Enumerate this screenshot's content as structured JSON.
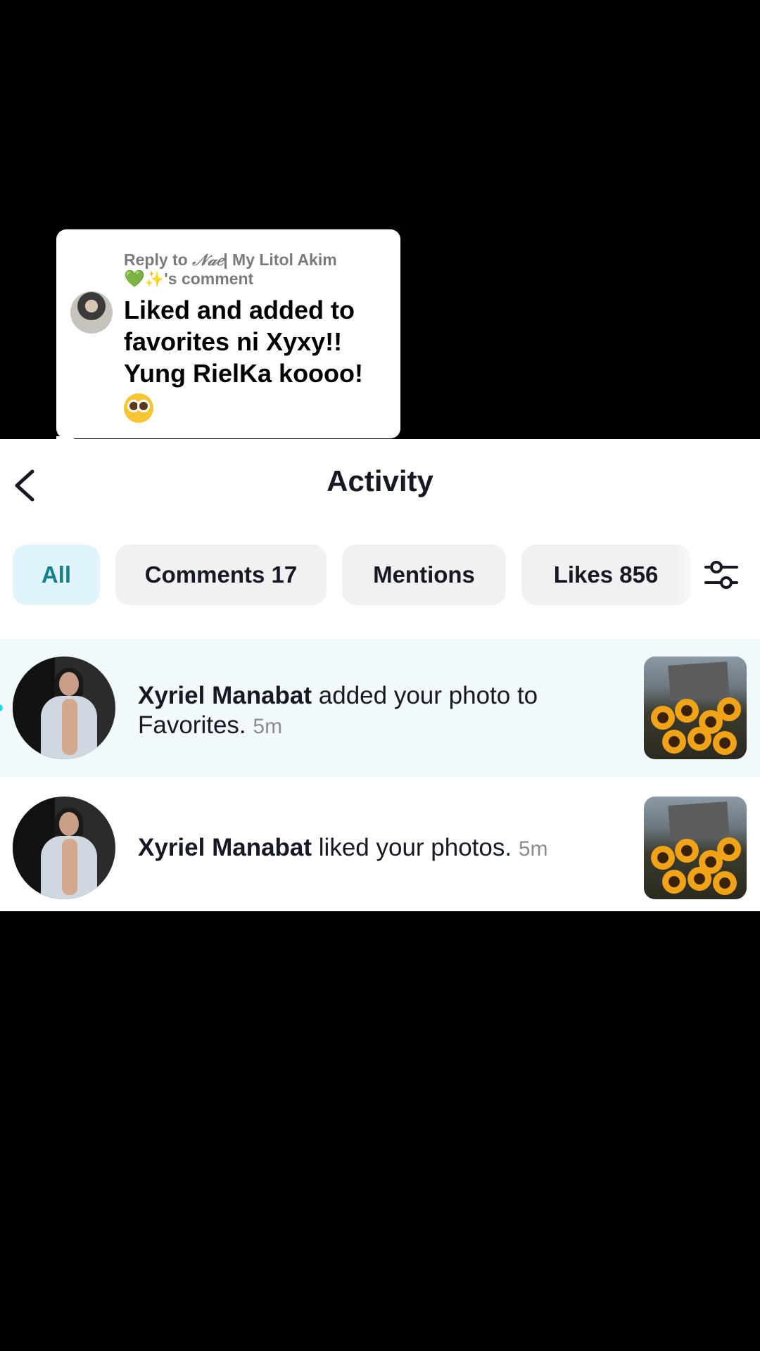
{
  "bubble": {
    "reply_prefix": "Reply to ",
    "reply_name": "𝒩𝒶𝑒",
    "reply_name_rest": "| My Litol Akim",
    "reply_emoji_heart": "💚",
    "reply_emoji_spark": "✨",
    "reply_suffix": "'s comment",
    "text": "Liked and added to favorites ni Xyxy!! Yung RielKa koooo!",
    "emoji": "pleading-face-emoji"
  },
  "header": {
    "title": "Activity",
    "back_icon": "chevron-left-icon"
  },
  "tabs": [
    {
      "label": "All",
      "active": true
    },
    {
      "label": "Comments 17",
      "active": false
    },
    {
      "label": "Mentions",
      "active": false
    },
    {
      "label": "Likes 856",
      "active": false
    }
  ],
  "filter_icon": "sliders-icon",
  "notifications": [
    {
      "name": "Xyriel Manabat",
      "action": " added your photo to Favorites.",
      "time": "5m",
      "highlighted": true
    },
    {
      "name": "Xyriel Manabat",
      "action": " liked your photos.",
      "time": "5m",
      "highlighted": false
    }
  ],
  "colors": {
    "active_tab_bg": "#dff5fb",
    "active_tab_text": "#15808e",
    "unread_dot": "#20d5ec"
  }
}
